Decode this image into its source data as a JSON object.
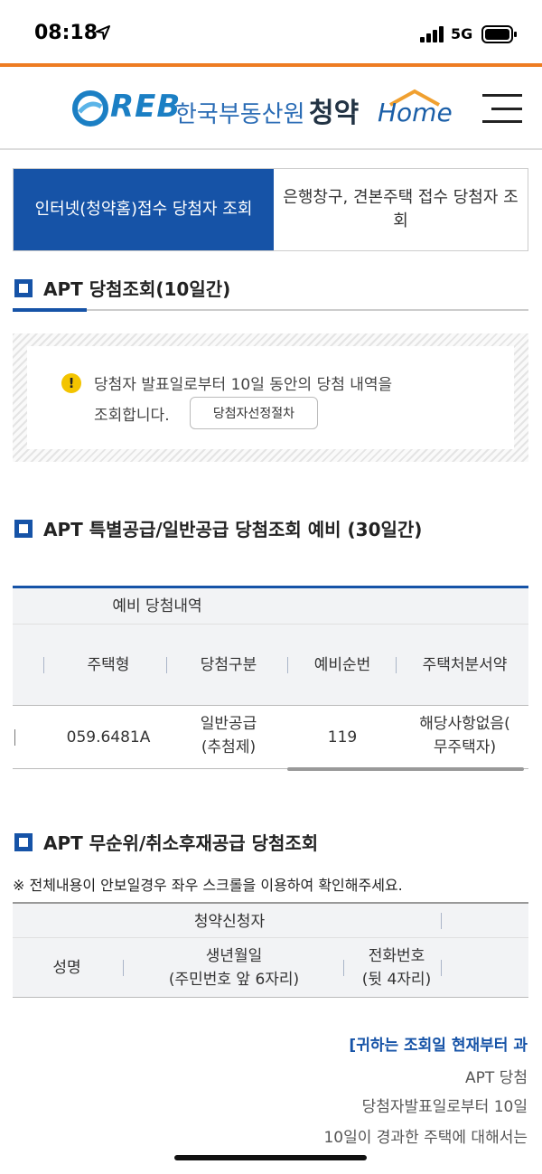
{
  "status": {
    "time": "08:18",
    "network": "5G"
  },
  "header": {
    "logo_reb": "REB",
    "logo_name": "한국부동산원",
    "logo_cheongyak": "청약",
    "logo_home": "Home"
  },
  "tabs": [
    {
      "label": "인터넷(청약홈)접수 당첨자 조회",
      "active": true
    },
    {
      "label": "은행창구, 견본주택 접수 당첨자 조회",
      "active": false
    }
  ],
  "section1": {
    "title": "APT 당첨조회(10일간)",
    "notice_line1": "당첨자 발표일로부터 10일 동안의 당첨 내역을",
    "notice_line2": "조회합니다.",
    "notice_button": "당첨자선정절차"
  },
  "section2": {
    "title": "APT 특별공급/일반공급 당첨조회 예비 (30일간)",
    "group_header": "예비 당첨내역",
    "columns": [
      "주택형",
      "당첨구분",
      "예비순번",
      "주택처분서약"
    ],
    "row": {
      "house_type": "059.6481A",
      "win_type_1": "일반공급",
      "win_type_2": "(추첨제)",
      "reserve_rank": "119",
      "disposal_1": "해당사항없음(",
      "disposal_2": "무주택자)"
    }
  },
  "section3": {
    "title": "APT 무순위/취소후재공급 당첨조회",
    "note": "※ 전체내용이 안보일경우 좌우 스크롤을 이용하여 확인해주세요.",
    "group_header": "청약신청자",
    "col_name": "성명",
    "col_birth_1": "생년월일",
    "col_birth_2": "(주민번호 앞 6자리)",
    "col_phone_1": "전화번호",
    "col_phone_2": "(뒷 4자리)"
  },
  "bottom": {
    "line1": "[귀하는 조회일 현재부터 과",
    "line2": "APT 당첨",
    "line3": "당첨자발표일로부터 10일",
    "line4": "10일이 경과한 주택에 대해서는"
  }
}
